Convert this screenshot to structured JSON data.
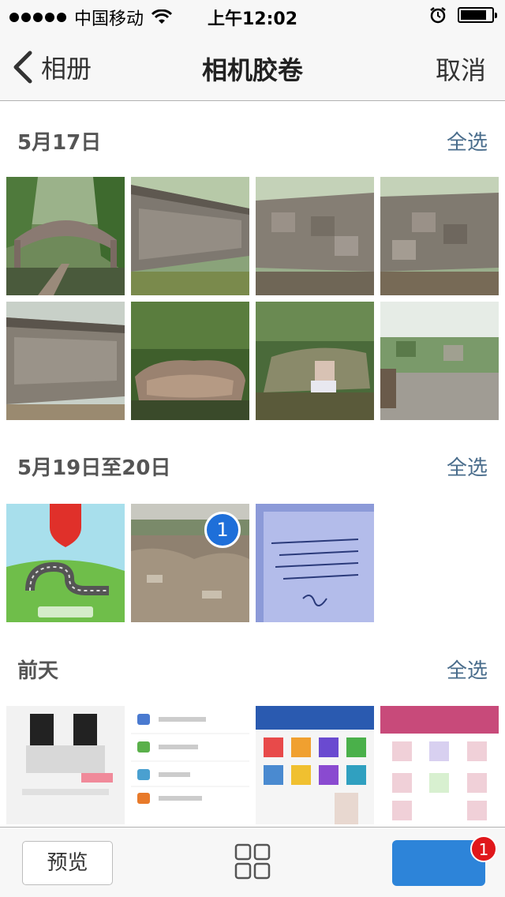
{
  "status_bar": {
    "carrier": "中国移动",
    "time": "上午12:02",
    "battery_level": 0.85
  },
  "nav": {
    "back_label": "相册",
    "title": "相机胶卷",
    "cancel_label": "取消"
  },
  "sections": [
    {
      "date": "5月17日",
      "select_all": "全选"
    },
    {
      "date": "5月19日至20日",
      "select_all": "全选"
    },
    {
      "date": "前天",
      "select_all": "全选"
    }
  ],
  "selection": {
    "badge_number": "1"
  },
  "toolbar": {
    "preview_label": "预览",
    "selected_count": "1"
  }
}
